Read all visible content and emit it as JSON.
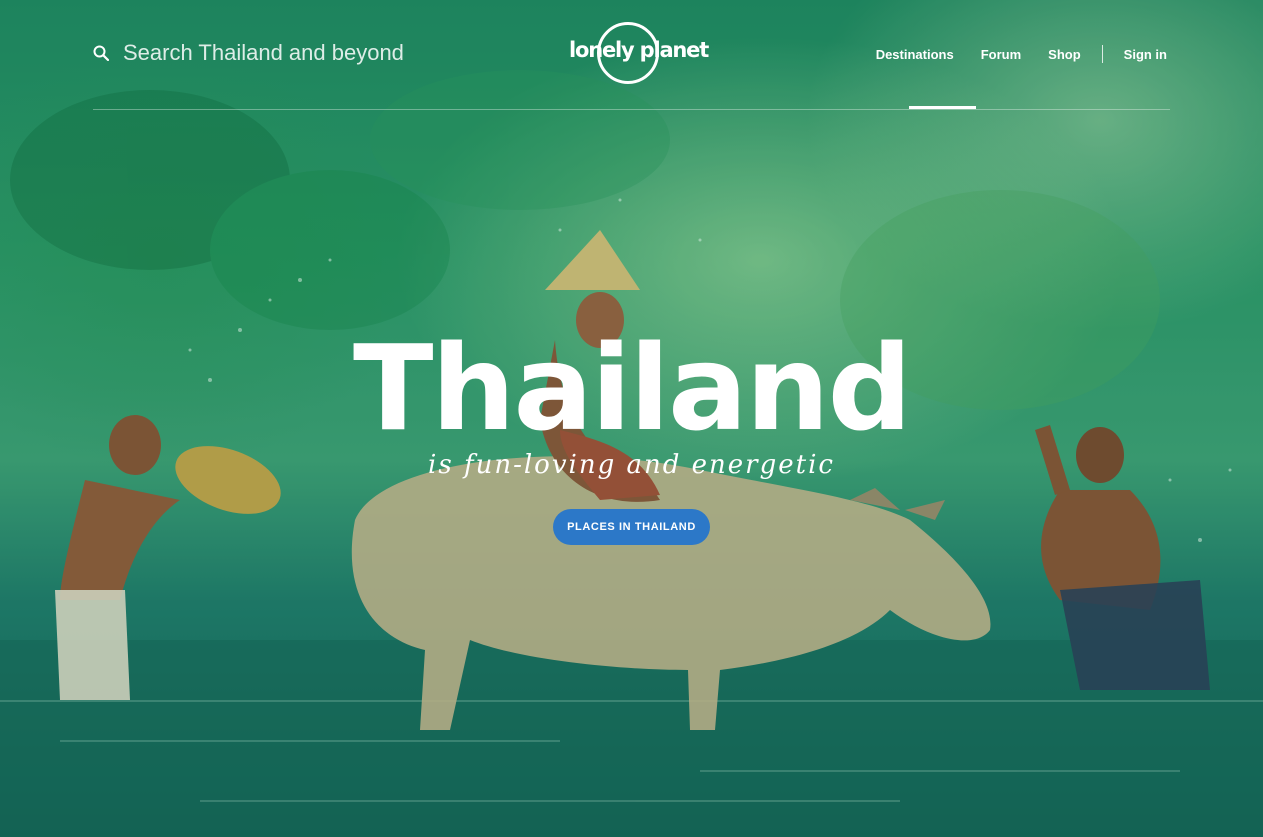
{
  "header": {
    "search": {
      "placeholder": "Search Thailand and beyond",
      "icon": "search-icon"
    },
    "logo_text": "lonely planet",
    "nav": {
      "items": [
        {
          "label": "Destinations",
          "active": true
        },
        {
          "label": "Forum"
        },
        {
          "label": "Shop"
        }
      ],
      "sign_in": "Sign in"
    }
  },
  "hero": {
    "title": "Thailand",
    "subtitle": "is fun-loving and energetic",
    "cta_label": "PLACES IN THAILAND",
    "background_image": "two boys splashing water around a boy in a conical hat riding a water buffalo in a river"
  },
  "colors": {
    "cta": "#2c78c8",
    "text": "#ffffff",
    "background_primary": "#2c9a6a"
  }
}
